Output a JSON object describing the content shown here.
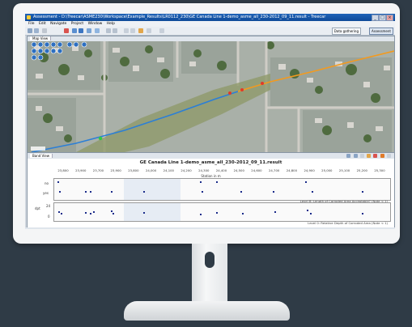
{
  "window": {
    "title": "Assessment - D:\\Treecar\\ASME230\\Workspace\\Example_Results\\LR0112_230\\GE Canada Line 1-demo_asme_all_230-2012_09_11.result - Treecar",
    "minimize": "_",
    "maximize": "□",
    "close": "×"
  },
  "menu": [
    "File",
    "Edit",
    "Navigate",
    "Project",
    "Window",
    "Help"
  ],
  "toolbar": {
    "perspective_label": "Data gathering",
    "assessment_label": "Assessment"
  },
  "map": {
    "tab_label": "Map View"
  },
  "band": {
    "tab_label": "Band View",
    "chart_title": "GE Canada Line 1-demo_asme_all_230-2012_09_11.result",
    "xlabel": "Station in m",
    "ticks": [
      "23,800",
      "23,900",
      "23,700",
      "23,900",
      "23,800",
      "24,000",
      "24,100",
      "24,200",
      "24,300",
      "24,400",
      "24,500",
      "24,600",
      "24,700",
      "24,800",
      "24,900",
      "25,000",
      "25,100",
      "25,200",
      "25,300"
    ],
    "plot1_labels": [
      "no",
      "yes"
    ],
    "plot1_caption": "Level B: Length of Corroded Area Acceptable? (Note < 1)",
    "plot2_labels": [
      "24",
      "0"
    ],
    "plot2_axis": "dpt",
    "plot2_caption": "Level 0: Relative Depth of Corroded Area (Note < 1)"
  }
}
